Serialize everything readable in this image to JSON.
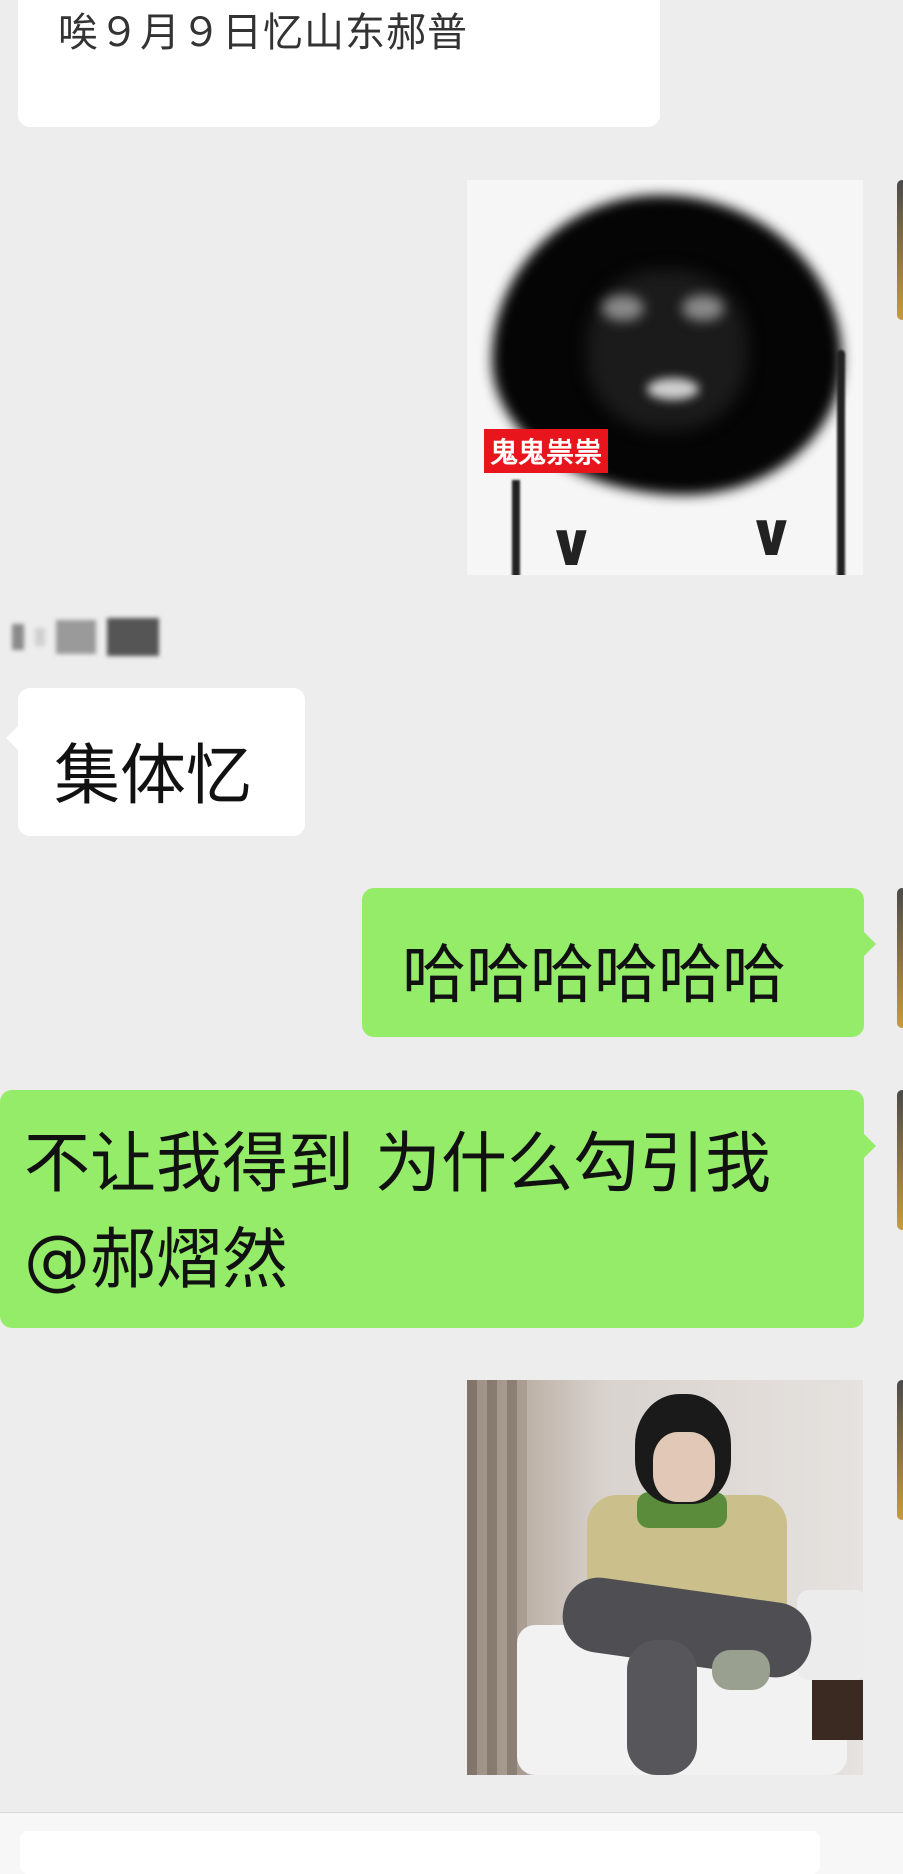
{
  "chat": {
    "messages": [
      {
        "side": "left",
        "type": "text",
        "text": "唉９月９日忆山东郝普",
        "partial": true
      },
      {
        "side": "right",
        "type": "sticker",
        "caption": "鬼鬼祟祟",
        "sticker_name": "blurred-cartoon-sticker"
      },
      {
        "side": "left",
        "type": "text",
        "text": "集体忆"
      },
      {
        "side": "right",
        "type": "text",
        "text": "哈哈哈哈哈哈"
      },
      {
        "side": "right",
        "type": "text",
        "text": "不让我得到 为什么勾引我 @郝熠然"
      },
      {
        "side": "right",
        "type": "image",
        "image_name": "person-sitting-on-sofa-photo"
      }
    ]
  },
  "colors": {
    "background": "#ededed",
    "incoming_bubble": "#ffffff",
    "outgoing_bubble": "#95ec69",
    "sticker_caption_bg": "#e8161c"
  },
  "icons": {
    "bubble_tail": "triangle-tail-icon"
  }
}
